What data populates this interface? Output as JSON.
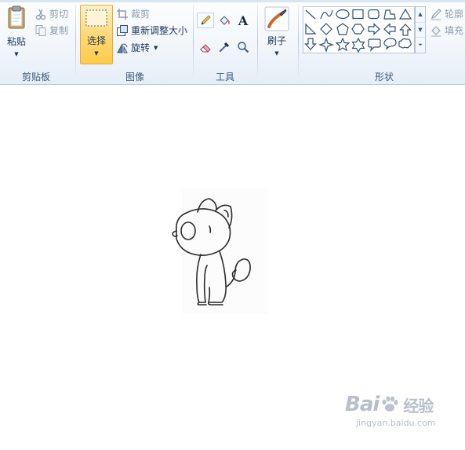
{
  "clipboard": {
    "paste_label": "粘贴",
    "cut_label": "剪切",
    "copy_label": "复制",
    "group_label": "剪贴板"
  },
  "image": {
    "select_label": "选择",
    "crop_label": "裁剪",
    "resize_label": "重新调整大小",
    "rotate_label": "旋转",
    "group_label": "图像"
  },
  "tools": {
    "group_label": "工具",
    "items": [
      "pencil-icon",
      "fill-icon",
      "text-icon",
      "eraser-icon",
      "color-picker-icon",
      "magnifier-icon"
    ],
    "text_glyph": "A"
  },
  "brushes": {
    "label": "刷子"
  },
  "shapes": {
    "group_label": "形状",
    "outline_label": "轮廓",
    "fill_label": "填充",
    "items": [
      "line",
      "curve",
      "oval",
      "rectangle",
      "rounded-rectangle",
      "polygon",
      "triangle",
      "right-triangle",
      "diamond",
      "pentagon",
      "hexagon",
      "right-arrow",
      "left-arrow",
      "up-arrow",
      "down-arrow",
      "four-point-star",
      "five-point-star",
      "six-point-star",
      "rounded-callout",
      "oval-callout",
      "cloud-callout"
    ]
  },
  "watermark": {
    "brand": "Bai",
    "brand_suffix": "经验",
    "url": "jingyan.baidu.com"
  },
  "colors": {
    "ribbon_bg": "#f2f6fb",
    "label_text": "#1e395b",
    "select_active": "#ffd977",
    "disabled_text": "#8c9bb0"
  }
}
